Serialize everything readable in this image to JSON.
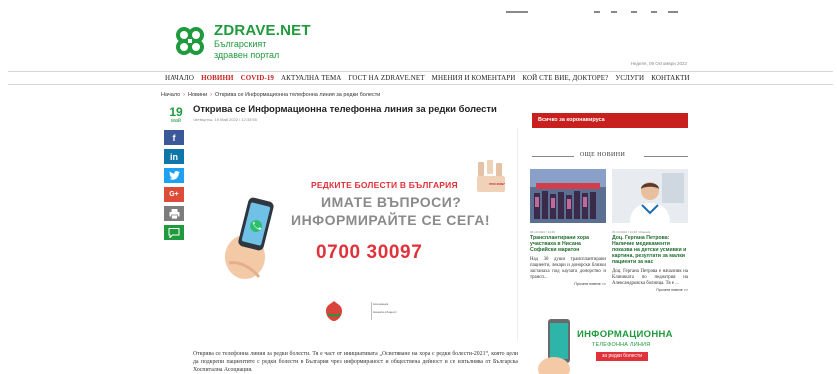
{
  "header": {
    "logo_name": "ZDRAVE.NET",
    "logo_sub_1": "Българският",
    "logo_sub_2": "здравен портал",
    "date_line": "Неделя, 09 Октомври 2022"
  },
  "nav": {
    "items": [
      {
        "label": "Начало"
      },
      {
        "label": "Новини"
      },
      {
        "label": "COVID-19"
      },
      {
        "label": "Актуална тема"
      },
      {
        "label": "Гост на Zdrave.net"
      },
      {
        "label": "Мнения и коментари"
      },
      {
        "label": "Кой сте вие, докторе?"
      },
      {
        "label": "Услуги"
      },
      {
        "label": "Контакти"
      }
    ]
  },
  "breadcrumb": {
    "home": "Начало",
    "section": "Новини",
    "current": "Открива се Информационна телефонна линия за редки болести"
  },
  "article": {
    "day": "19",
    "month": "май",
    "title": "Открива се Информационна телефонна линия за редки болести",
    "meta": "Четвъртък, 19 Май 2022 / 12:33:55",
    "hero_line_1": "РЕДКИТЕ БОЛЕСТИ В БЪЛГАРИЯ",
    "hero_line_2": "ИМАТЕ ВЪПРОСИ?",
    "hero_line_3": "ИНФОРМИРАЙТЕ СЕ СЕГА!",
    "hero_phone": "0700 30097",
    "hero_corner_label": "0700 30097",
    "hero_logo_text_1": "Асоциация",
    "hero_logo_text_2": "Нашата общност",
    "body": "Открива се телефонна линия за редки болести. Тя е част от инициативата „Осветяване на хора с редки болести-2021“, която цели да подкрепи пациентите с редки болести в България чрез информираност и обществена дейност и се изпълнява от Българска Хоспитална Асоциация."
  },
  "share": {
    "fb": "f",
    "li": "in",
    "gp": "G+"
  },
  "sidebar": {
    "covid_label": "Всичко за коронавируса",
    "more_news_label": "ОЩЕ НОВИНИ",
    "cards": [
      {
        "meta": "06.10.2022 / 14:46",
        "title": "Трансплантирани хора участваха в Нисана Софийски маратон",
        "excerpt": "Над 30 души трансплантирани пациенти, лекари и донорски близки застанаха под каузата донорство и трансп...",
        "readmore": "Прочети повече >>"
      },
      {
        "meta": "06.10.2022 / 14:46 / Мнения",
        "title": "Доц. Гергана Петрова: Наличие медикаменти показва на детски усмивки и картина, резултати за малки пациенти за нас",
        "excerpt": "Доц. Гергана Петрова е началник на Клиниката по педиатрия на Александровска болница. Тя е ...",
        "readmore": "Прочети повече >>"
      }
    ],
    "promo_title": "ИНФОРМАЦИОННА",
    "promo_sub": "ТЕЛЕФОННА ЛИНИЯ",
    "promo_tag": "за редки болести"
  }
}
